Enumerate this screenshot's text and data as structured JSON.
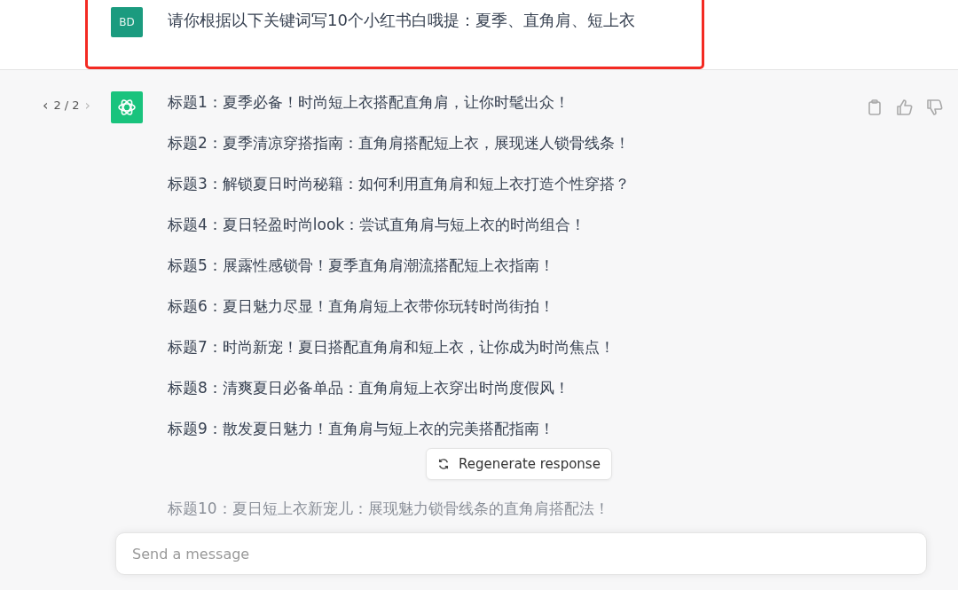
{
  "user_message": {
    "avatar": "BD",
    "text": "请你根据以下关键词写10个小红书白哦提：夏季、直角肩、短上衣",
    "highlighted": true
  },
  "assistant_message": {
    "pager": {
      "prev": "‹",
      "label": "2 / 2",
      "next": "›"
    },
    "lines": [
      "标题1：夏季必备！时尚短上衣搭配直角肩，让你时髦出众！",
      "标题2：夏季清凉穿搭指南：直角肩搭配短上衣，展现迷人锁骨线条！",
      "标题3：解锁夏日时尚秘籍：如何利用直角肩和短上衣打造个性穿搭？",
      "标题4：夏日轻盈时尚look：尝试直角肩与短上衣的时尚组合！",
      "标题5：展露性感锁骨！夏季直角肩潮流搭配短上衣指南！",
      "标题6：夏日魅力尽显！直角肩短上衣带你玩转时尚街拍！",
      "标题7：时尚新宠！夏日搭配直角肩和短上衣，让你成为时尚焦点！",
      "标题8：清爽夏日必备单品：直角肩短上衣穿出时尚度假风！",
      "标题9：散发夏日魅力！直角肩与短上衣的完美搭配指南！",
      "标题10：夏日短上衣新宠儿：展现魅力锁骨线条的直角肩搭配法！"
    ]
  },
  "regenerate_button": "Regenerate response",
  "composer": {
    "placeholder": "Send a message"
  }
}
